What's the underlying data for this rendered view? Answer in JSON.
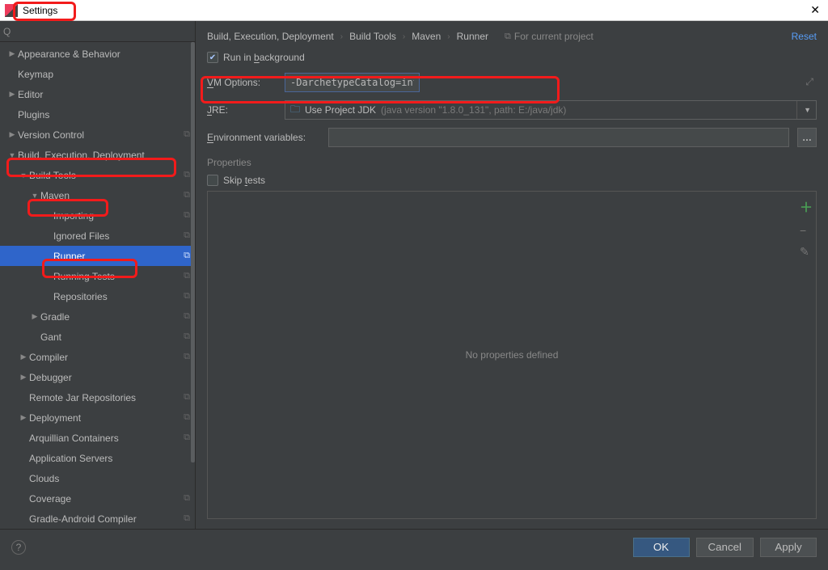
{
  "window": {
    "title": "Settings",
    "close": "✕"
  },
  "sidebar": {
    "search_placeholder": "",
    "items": [
      {
        "label": "Appearance & Behavior",
        "chev": "▶",
        "indent": 0,
        "copy": false
      },
      {
        "label": "Keymap",
        "chev": "",
        "indent": 0,
        "copy": false
      },
      {
        "label": "Editor",
        "chev": "▶",
        "indent": 0,
        "copy": false
      },
      {
        "label": "Plugins",
        "chev": "",
        "indent": 0,
        "copy": false
      },
      {
        "label": "Version Control",
        "chev": "▶",
        "indent": 0,
        "copy": true
      },
      {
        "label": "Build, Execution, Deployment",
        "chev": "▼",
        "indent": 0,
        "copy": false
      },
      {
        "label": "Build Tools",
        "chev": "▼",
        "indent": 1,
        "copy": true
      },
      {
        "label": "Maven",
        "chev": "▼",
        "indent": 2,
        "copy": true
      },
      {
        "label": "Importing",
        "chev": "",
        "indent": 3,
        "copy": true
      },
      {
        "label": "Ignored Files",
        "chev": "",
        "indent": 3,
        "copy": true
      },
      {
        "label": "Runner",
        "chev": "",
        "indent": 3,
        "copy": true,
        "selected": true
      },
      {
        "label": "Running Tests",
        "chev": "",
        "indent": 3,
        "copy": true
      },
      {
        "label": "Repositories",
        "chev": "",
        "indent": 3,
        "copy": true
      },
      {
        "label": "Gradle",
        "chev": "▶",
        "indent": 2,
        "copy": true
      },
      {
        "label": "Gant",
        "chev": "",
        "indent": 2,
        "copy": true
      },
      {
        "label": "Compiler",
        "chev": "▶",
        "indent": 1,
        "copy": true
      },
      {
        "label": "Debugger",
        "chev": "▶",
        "indent": 1,
        "copy": false
      },
      {
        "label": "Remote Jar Repositories",
        "chev": "",
        "indent": 1,
        "copy": true
      },
      {
        "label": "Deployment",
        "chev": "▶",
        "indent": 1,
        "copy": true
      },
      {
        "label": "Arquillian Containers",
        "chev": "",
        "indent": 1,
        "copy": true
      },
      {
        "label": "Application Servers",
        "chev": "",
        "indent": 1,
        "copy": false
      },
      {
        "label": "Clouds",
        "chev": "",
        "indent": 1,
        "copy": false
      },
      {
        "label": "Coverage",
        "chev": "",
        "indent": 1,
        "copy": true
      },
      {
        "label": "Gradle-Android Compiler",
        "chev": "",
        "indent": 1,
        "copy": true
      }
    ]
  },
  "breadcrumb": {
    "items": [
      "Build, Execution, Deployment",
      "Build Tools",
      "Maven",
      "Runner"
    ],
    "for_project": "For current project",
    "reset": "Reset"
  },
  "form": {
    "run_bg_label": "Run in background",
    "run_bg_pre": "Run in ",
    "run_bg_u": "b",
    "run_bg_post": "ackground",
    "vm_label": "VM Options:",
    "vm_u": "V",
    "vm_rest": "M Options:",
    "vm_value": "-DarchetypeCatalog=internal",
    "jre_label": "JRE:",
    "jre_u": "J",
    "jre_rest": "RE:",
    "jre_text": "Use Project JDK",
    "jre_hint": "(java version \"1.8.0_131\", path: E:/java/jdk)",
    "env_label": "Environment variables:",
    "env_u": "E",
    "env_rest": "nvironment variables:",
    "env_more": "…",
    "properties_label": "Properties",
    "skip_label": "Skip tests",
    "skip_u": "t",
    "skip_pre": "Skip ",
    "skip_post": "ests",
    "empty_text": "No properties defined"
  },
  "buttons": {
    "ok": "OK",
    "cancel": "Cancel",
    "apply": "Apply",
    "help": "?"
  }
}
